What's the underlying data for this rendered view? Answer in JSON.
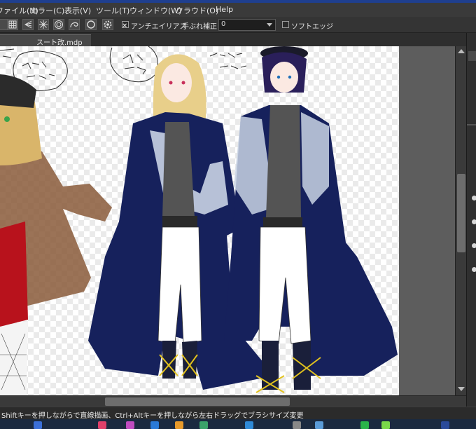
{
  "menu": [
    "ファイル(N)",
    "カラー(C)",
    "表示(V)",
    "ツール(T)",
    "ウィンドウ(W)",
    "クラウド(O)",
    "Help"
  ],
  "toolbar": {
    "antialias_label": "アンチエイリアス",
    "stabilizer_label": "手ぶれ補正",
    "stabilizer_value": "0",
    "soft_edge_label": "ソフトエッジ"
  },
  "document": {
    "tab_title": "スート改.mdp"
  },
  "status": {
    "hint": "Shiftキーを押しながらで直線描画、Ctrl+Altキーを押しながら左右ドラッグでブラシサイズ変更"
  },
  "colors": {
    "accent": "#1f3f8f",
    "coat_navy": "#16215c",
    "coat_brown": "#8a5a3a",
    "hair_blonde": "#e8cf8a",
    "red": "#b8121c"
  }
}
